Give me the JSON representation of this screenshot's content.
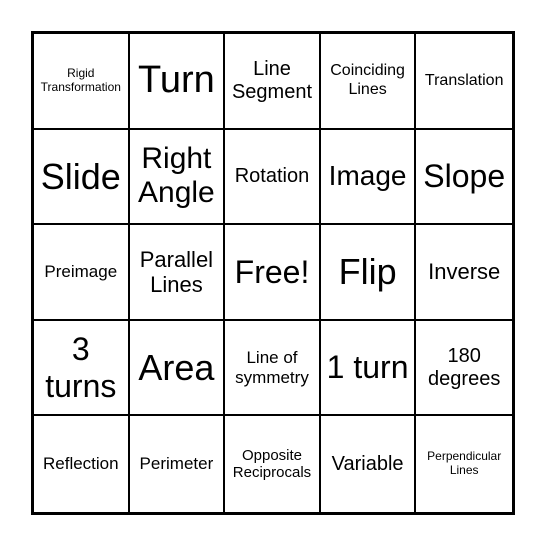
{
  "cells": [
    {
      "text": "Rigid Transformation",
      "size": 12
    },
    {
      "text": "Turn",
      "size": 38
    },
    {
      "text": "Line Segment",
      "size": 20
    },
    {
      "text": "Coinciding Lines",
      "size": 16
    },
    {
      "text": "Translation",
      "size": 16
    },
    {
      "text": "Slide",
      "size": 36
    },
    {
      "text": "Right Angle",
      "size": 30
    },
    {
      "text": "Rotation",
      "size": 20
    },
    {
      "text": "Image",
      "size": 28
    },
    {
      "text": "Slope",
      "size": 32
    },
    {
      "text": "Preimage",
      "size": 17
    },
    {
      "text": "Parallel Lines",
      "size": 22
    },
    {
      "text": "Free!",
      "size": 32
    },
    {
      "text": "Flip",
      "size": 36
    },
    {
      "text": "Inverse",
      "size": 22
    },
    {
      "text": "3 turns",
      "size": 32
    },
    {
      "text": "Area",
      "size": 36
    },
    {
      "text": "Line of symmetry",
      "size": 17
    },
    {
      "text": "1 turn",
      "size": 32
    },
    {
      "text": "180 degrees",
      "size": 20
    },
    {
      "text": "Reflection",
      "size": 17
    },
    {
      "text": "Perimeter",
      "size": 17
    },
    {
      "text": "Opposite Reciprocals",
      "size": 15
    },
    {
      "text": "Variable",
      "size": 20
    },
    {
      "text": "Perpendicular Lines",
      "size": 12
    }
  ]
}
